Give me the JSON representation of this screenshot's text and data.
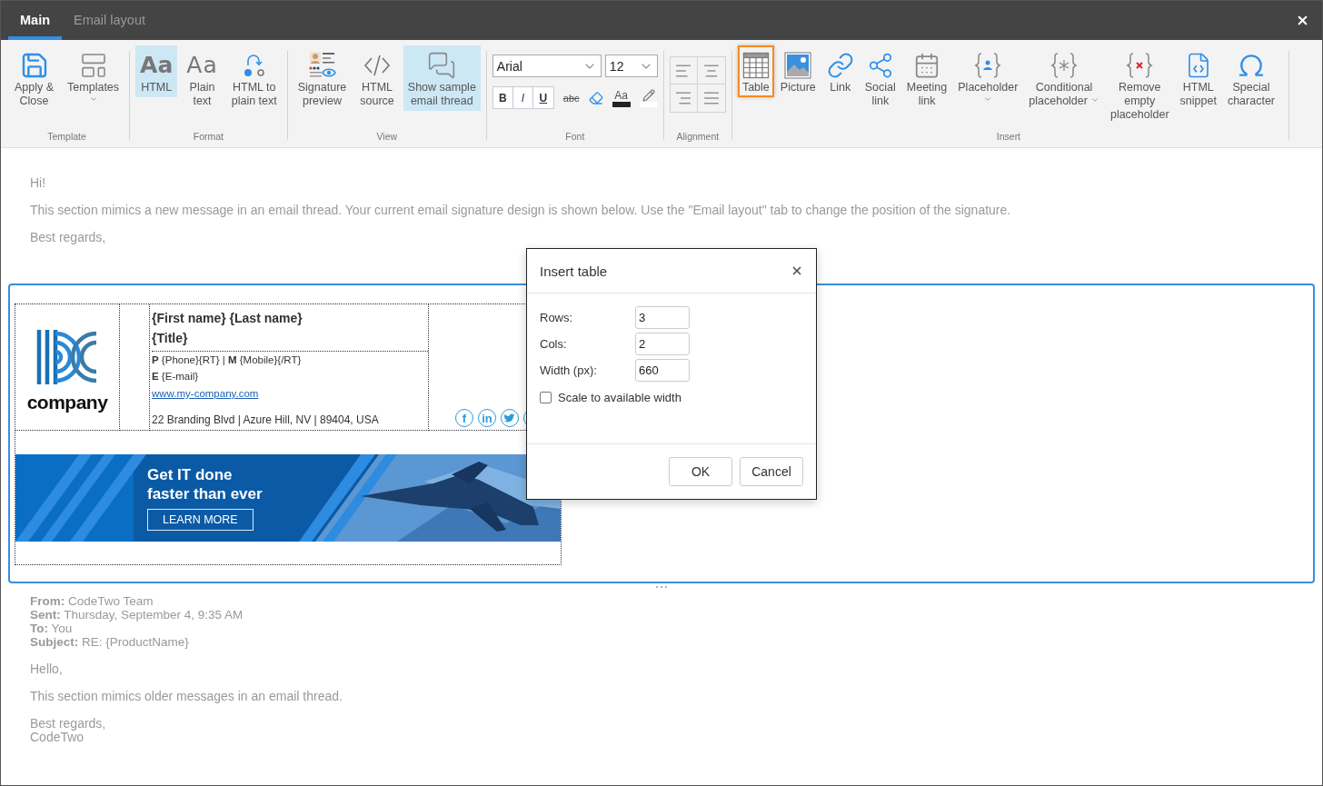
{
  "tabs": [
    {
      "label": "Main",
      "selected": true
    },
    {
      "label": "Email layout",
      "selected": false
    }
  ],
  "ribbon": {
    "groups": [
      {
        "label": "Template",
        "kind": "buttons",
        "items": [
          {
            "label": "Apply &\nClose",
            "selected": false,
            "focused": false,
            "dropdown": false
          },
          {
            "label": "Templates",
            "selected": false,
            "focused": false,
            "dropdown": true
          }
        ]
      },
      {
        "label": "Format",
        "kind": "buttons",
        "items": [
          {
            "glyph": "Aa",
            "label": "HTML",
            "selected": true,
            "focused": false,
            "dropdown": false
          },
          {
            "glyph": "Aa",
            "label": "Plain\ntext",
            "selected": false,
            "focused": false,
            "dropdown": false
          },
          {
            "label": "HTML to\nplain text",
            "selected": false,
            "focused": false,
            "dropdown": false
          }
        ]
      },
      {
        "label": "View",
        "kind": "buttons",
        "items": [
          {
            "label": "Signature\npreview",
            "selected": false,
            "focused": false,
            "dropdown": false
          },
          {
            "label": "HTML\nsource",
            "selected": false,
            "focused": false,
            "dropdown": false
          },
          {
            "label": "Show sample\nemail thread",
            "selected": true,
            "focused": false,
            "dropdown": false
          }
        ]
      },
      {
        "label": "Font",
        "kind": "font",
        "font": "Arial",
        "size": "12",
        "styles": [
          "B",
          "I",
          "U"
        ],
        "tools": [
          {
            "kind": "strike",
            "glyph": "abc"
          },
          {
            "kind": "clear"
          },
          {
            "kind": "color",
            "glyph": "Aa"
          },
          {
            "kind": "highlight"
          }
        ]
      },
      {
        "label": "Alignment",
        "kind": "align",
        "items": [
          {
            "selected": false
          },
          {
            "selected": false
          },
          {
            "selected": false
          },
          {
            "selected": false
          }
        ]
      },
      {
        "label": "Insert",
        "kind": "buttons",
        "items": [
          {
            "label": "Table",
            "selected": false,
            "focused": true,
            "dropdown": false
          },
          {
            "label": "Picture",
            "selected": false,
            "focused": false,
            "dropdown": false
          },
          {
            "label": "Link",
            "selected": false,
            "focused": false,
            "dropdown": false
          },
          {
            "label": "Social\nlink",
            "selected": false,
            "focused": false,
            "dropdown": false
          },
          {
            "label": "Meeting\nlink",
            "selected": false,
            "focused": false,
            "dropdown": false
          },
          {
            "label": "Placeholder",
            "selected": false,
            "focused": false,
            "dropdown": true
          },
          {
            "label": "Conditional\nplaceholder",
            "selected": false,
            "focused": false,
            "dropdown": true
          },
          {
            "label": "Remove\nempty\nplaceholder",
            "selected": false,
            "focused": false,
            "dropdown": false
          },
          {
            "label": "HTML\nsnippet",
            "selected": false,
            "focused": false,
            "dropdown": false
          },
          {
            "label": "Special\ncharacter",
            "selected": false,
            "focused": false,
            "dropdown": false
          }
        ]
      }
    ]
  },
  "message": {
    "paragraphs": [
      "Hi!",
      "This section mimics a new message in an email thread. Your current email signature design is shown below. Use the \"Email layout\" tab to change the position of the signature.",
      "Best regards,"
    ]
  },
  "signature": {
    "logo_text": "company",
    "name": "{First name} {Last name}",
    "title": "{Title}",
    "contact_lines": [
      "**P** {Phone}{RT} | **M** {Mobile}{/RT}",
      "**E** {E-mail}"
    ],
    "website": "www.my-company.com",
    "address": "22 Branding Blvd | Azure Hill, NV | 89404, USA",
    "social_links": [
      {
        "kind": "letter",
        "glyph": "f"
      },
      {
        "kind": "letter",
        "glyph": "in"
      },
      {
        "kind": "bird"
      },
      {
        "kind": "circle"
      }
    ],
    "banner": {
      "headline": "Get IT done\nfaster than ever",
      "button": "LEARN MORE"
    }
  },
  "quoted": {
    "header": [
      {
        "label": "From:",
        "value": "CodeTwo Team"
      },
      {
        "label": "Sent:",
        "value": "Thursday, September 4, 9:35 AM"
      },
      {
        "label": "To:",
        "value": "You"
      },
      {
        "label": "Subject:",
        "value": "RE: {ProductName}"
      }
    ],
    "paragraphs": [
      "Hello,",
      "This section mimics older messages in an email thread.",
      "Best regards,\nCodeTwo"
    ]
  },
  "dialog": {
    "title": "Insert table",
    "fields": [
      {
        "label": "Rows:",
        "value": "3"
      },
      {
        "label": "Cols:",
        "value": "2"
      },
      {
        "label": "Width (px):",
        "value": "660"
      }
    ],
    "checkbox": {
      "label": "Scale to available width",
      "checked": false
    },
    "buttons": [
      "OK",
      "Cancel"
    ]
  }
}
